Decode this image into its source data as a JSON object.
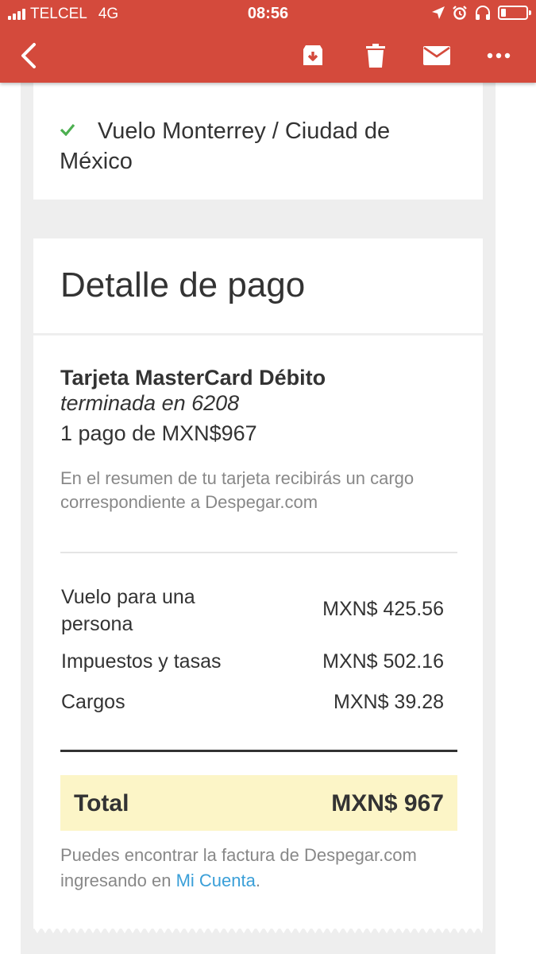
{
  "status_bar": {
    "carrier": "TELCEL",
    "network": "4G",
    "time": "08:56",
    "battery_level": 0.2
  },
  "toolbar": {
    "back_icon": "chevron-left-icon",
    "actions": [
      "archive-icon",
      "trash-icon",
      "mail-icon",
      "more-icon"
    ]
  },
  "itinerary": {
    "item": "Vuelo Monterrey / Ciudad de México"
  },
  "payment": {
    "title": "Detalle de pago",
    "card_name": "Tarjeta MasterCard Débito",
    "card_ending": "terminada en 6208",
    "installments": "1 pago de MXN$967",
    "summary_note": "En el resumen de tu tarjeta recibirás un cargo correspondiente a Despegar.com",
    "line_items": [
      {
        "label": "Vuelo para una persona",
        "amount": "MXN$ 425.56"
      },
      {
        "label": "Impuestos y tasas",
        "amount": "MXN$ 502.16"
      },
      {
        "label": "Cargos",
        "amount": "MXN$ 39.28"
      }
    ],
    "total_label": "Total",
    "total_amount": "MXN$ 967",
    "invoice_note_prefix": "Puedes encontrar la factura de Despegar.com ingresando en ",
    "invoice_link": "Mi Cuenta",
    "invoice_note_suffix": "."
  },
  "colors": {
    "toolbar_bg": "#d44a3c",
    "check_green": "#4caf50",
    "total_bg": "#fcf5c7",
    "link_blue": "#3a9fd8"
  }
}
